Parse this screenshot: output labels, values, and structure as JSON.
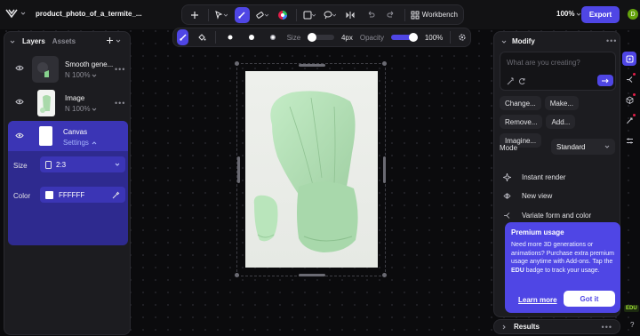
{
  "header": {
    "project_title": "product_photo_of_a_termite_...",
    "workbench_label": "Workbench",
    "zoom": "100%",
    "export_label": "Export",
    "avatar_letter": "D"
  },
  "brush_toolbar": {
    "size_label": "Size",
    "size_value": "4px",
    "size_fraction": 0.12,
    "opacity_label": "Opacity",
    "opacity_value": "100%",
    "opacity_fraction": 1.0
  },
  "left_panel": {
    "tab_layers": "Layers",
    "tab_assets": "Assets",
    "layers": [
      {
        "name": "Smooth gene...",
        "meta": "N 100%"
      },
      {
        "name": "Image",
        "meta": "N 100%"
      },
      {
        "name": "Canvas",
        "meta": "Settings"
      }
    ],
    "size_label": "Size",
    "size_value": "2:3",
    "color_label": "Color",
    "color_value": "FFFFFF"
  },
  "modify_panel": {
    "title": "Modify",
    "prompt_placeholder": "What are you creating?",
    "chips": [
      "Change...",
      "Make...",
      "Remove...",
      "Add...",
      "Imagine..."
    ],
    "mode_label": "Mode",
    "mode_value": "Standard",
    "actions": [
      "Instant render",
      "New view",
      "Variate form and color"
    ]
  },
  "premium": {
    "title": "Premium usage",
    "body_prefix": "Need more 3D generations or animations? Purchase extra premium usage anytime with Add-ons. Tap the ",
    "body_bold": "EDU",
    "body_suffix": " badge to track your usage.",
    "learn_more": "Learn more",
    "got_it": "Got it"
  },
  "results": {
    "title": "Results"
  },
  "edu_badge": "EDU",
  "help_label": "?",
  "colors": {
    "accent": "#4f46e5",
    "panel": "#1c1c20",
    "selected_layer": "#3b35b5",
    "premium_card": "#4f46e5",
    "chair": "#b6e0b8"
  }
}
